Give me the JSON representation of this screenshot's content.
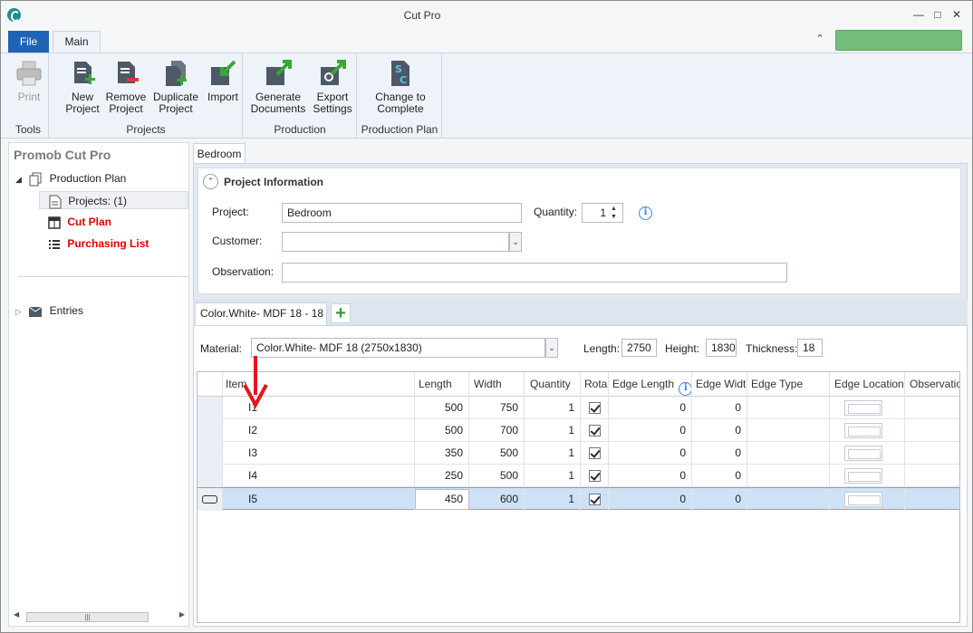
{
  "window": {
    "title": "Cut Pro"
  },
  "ribbon": {
    "file_tab": "File",
    "main_tab": "Main",
    "groups": [
      {
        "label": "Tools",
        "buttons": [
          "Print"
        ]
      },
      {
        "label": "Projects",
        "buttons": [
          "New Project",
          "Remove Project",
          "Duplicate Project",
          "Import"
        ]
      },
      {
        "label": "Production",
        "buttons": [
          "Generate Documents",
          "Export Settings"
        ]
      },
      {
        "label": "Production Plan",
        "buttons": [
          "Change to Complete"
        ]
      }
    ],
    "btn": {
      "print": "Print",
      "new1": "New",
      "new2": "Project",
      "remove1": "Remove",
      "remove2": "Project",
      "dup1": "Duplicate",
      "dup2": "Project",
      "import": "Import",
      "gen1": "Generate",
      "gen2": "Documents",
      "exp1": "Export",
      "exp2": "Settings",
      "chg1": "Change to",
      "chg2": "Complete"
    },
    "colors": {
      "file_tab": "#1f62b8",
      "status_green": "#74bc78"
    }
  },
  "sidebar": {
    "title": "Promob Cut Pro",
    "items": [
      {
        "label": "Production Plan"
      },
      {
        "label": "Projects: (1)"
      },
      {
        "label": "Cut Plan",
        "color": "#e00000"
      },
      {
        "label": "Purchasing List",
        "color": "#e00000"
      },
      {
        "label": "Entries"
      }
    ]
  },
  "document": {
    "tab": "Bedroom",
    "section_title": "Project Information",
    "labels": {
      "project": "Project:",
      "customer": "Customer:",
      "observation": "Observation:",
      "quantity": "Quantity:"
    },
    "values": {
      "project": "Bedroom",
      "customer": "",
      "observation": "",
      "quantity": "1"
    }
  },
  "material": {
    "tab": "Color.White- MDF 18 - 18",
    "add_icon": "plus-icon",
    "labels": {
      "material": "Material:",
      "length": "Length:",
      "height": "Height:",
      "thickness": "Thickness:"
    },
    "values": {
      "material": "Color.White- MDF 18 (2750x1830)",
      "length": "2750",
      "height": "1830",
      "thickness": "18"
    }
  },
  "grid": {
    "columns": [
      "Item",
      "Length",
      "Width",
      "Quantity",
      "Rota",
      "Edge Length",
      "Edge Widt",
      "Edge Type",
      "Edge Location",
      "Observatio"
    ],
    "rows": [
      {
        "item": "I1",
        "length": "500",
        "width": "750",
        "quantity": "1",
        "rotate": true,
        "edge_length": "0",
        "edge_width": "0"
      },
      {
        "item": "I2",
        "length": "500",
        "width": "700",
        "quantity": "1",
        "rotate": true,
        "edge_length": "0",
        "edge_width": "0"
      },
      {
        "item": "I3",
        "length": "350",
        "width": "500",
        "quantity": "1",
        "rotate": true,
        "edge_length": "0",
        "edge_width": "0"
      },
      {
        "item": "I4",
        "length": "250",
        "width": "500",
        "quantity": "1",
        "rotate": true,
        "edge_length": "0",
        "edge_width": "0"
      },
      {
        "item": "I5",
        "length": "450",
        "width": "600",
        "quantity": "1",
        "rotate": true,
        "edge_length": "0",
        "edge_width": "0"
      }
    ]
  }
}
